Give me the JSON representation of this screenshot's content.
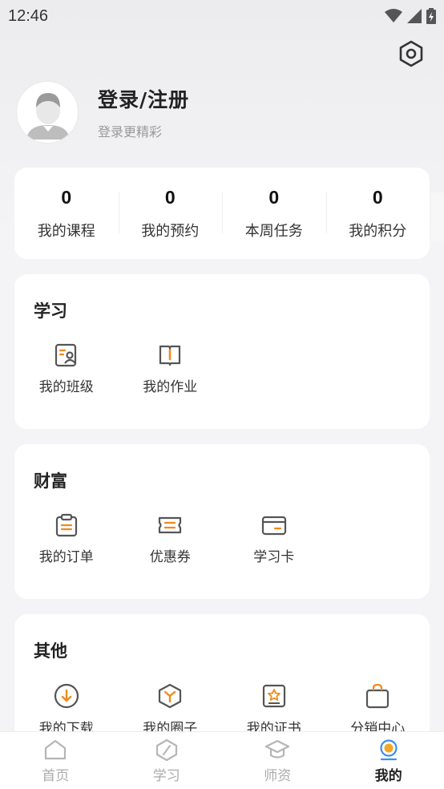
{
  "status": {
    "time": "12:46"
  },
  "profile": {
    "title": "登录/注册",
    "subtitle": "登录更精彩"
  },
  "stats": [
    {
      "value": "0",
      "label": "我的课程"
    },
    {
      "value": "0",
      "label": "我的预约"
    },
    {
      "value": "0",
      "label": "本周任务"
    },
    {
      "value": "0",
      "label": "我的积分"
    }
  ],
  "sections": {
    "learn": {
      "title": "学习",
      "items": [
        {
          "label": "我的班级"
        },
        {
          "label": "我的作业"
        }
      ]
    },
    "wealth": {
      "title": "财富",
      "items": [
        {
          "label": "我的订单"
        },
        {
          "label": "优惠券"
        },
        {
          "label": "学习卡"
        }
      ]
    },
    "other": {
      "title": "其他",
      "items": [
        {
          "label": "我的下载"
        },
        {
          "label": "我的圈子"
        },
        {
          "label": "我的证书"
        },
        {
          "label": "分销中心"
        }
      ]
    }
  },
  "tabs": [
    {
      "label": "首页"
    },
    {
      "label": "学习"
    },
    {
      "label": "师资"
    },
    {
      "label": "我的"
    }
  ],
  "colors": {
    "accent": "#f08a1c",
    "icon_stroke": "#555555",
    "active_tab": "#f5a623"
  }
}
